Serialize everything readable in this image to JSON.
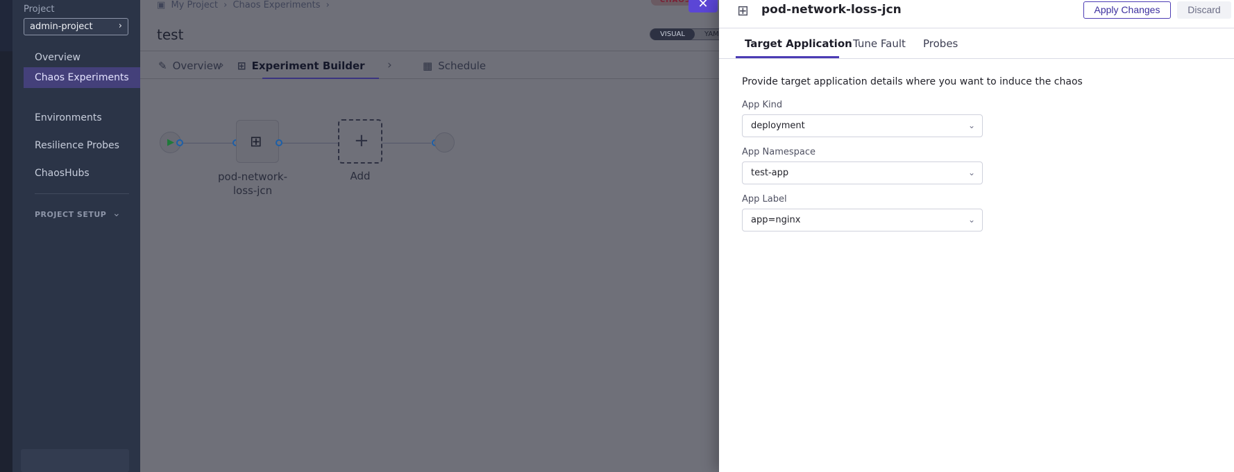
{
  "sidebar": {
    "project_label": "Project",
    "project_name": "admin-project",
    "items": [
      {
        "label": "Overview"
      },
      {
        "label": "Chaos Experiments"
      },
      {
        "label": "Environments"
      },
      {
        "label": "Resilience Probes"
      },
      {
        "label": "ChaosHubs"
      }
    ],
    "project_setup_label": "PROJECT SETUP"
  },
  "breadcrumb": [
    "My Project",
    "Chaos Experiments"
  ],
  "page": {
    "title": "test",
    "toggle_visual": "VISUAL",
    "toggle_yaml": "YAML",
    "badge": "CHAOS"
  },
  "builder_tabs": [
    {
      "label": "Overview",
      "icon": "pencil-icon"
    },
    {
      "label": "Experiment Builder",
      "icon": "fault-icon"
    },
    {
      "label": "Schedule",
      "icon": "calendar-icon"
    }
  ],
  "canvas": {
    "fault_node_label_line1": "pod-network-",
    "fault_node_label_line2": "loss-jcn",
    "add_label": "Add"
  },
  "drawer": {
    "title": "pod-network-loss-jcn",
    "apply_label": "Apply Changes",
    "discard_label": "Discard",
    "tabs": [
      {
        "label": "Target Application"
      },
      {
        "label": "Tune Fault"
      },
      {
        "label": "Probes"
      }
    ],
    "intro": "Provide target application details where you want to induce the chaos",
    "fields": [
      {
        "label": "App Kind",
        "value": "deployment"
      },
      {
        "label": "App Namespace",
        "value": "test-app"
      },
      {
        "label": "App Label",
        "value": "app=nginx"
      }
    ]
  },
  "colors": {
    "accent": "#4b3bb4",
    "sidebar_bg": "#2b3447",
    "overlay_bg": "#6f7079"
  }
}
